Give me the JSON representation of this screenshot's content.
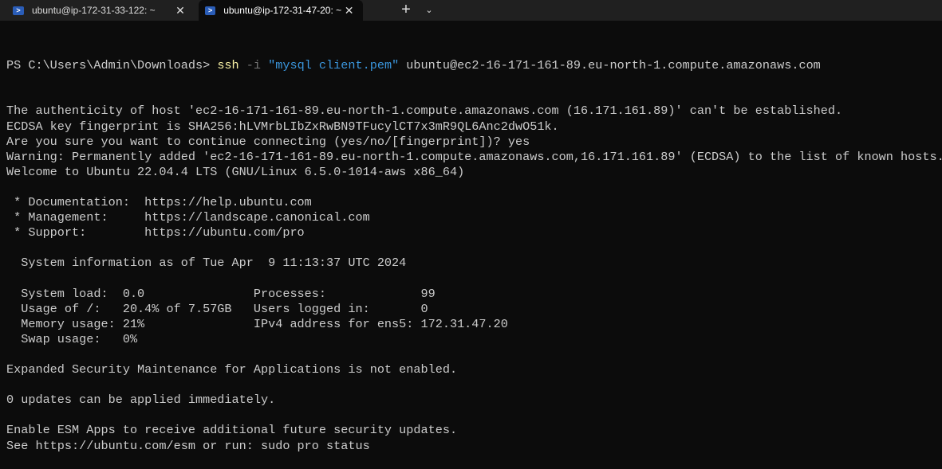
{
  "tabs": [
    {
      "title": "ubuntu@ip-172-31-33-122: ~",
      "icon": "powershell-icon",
      "active": false
    },
    {
      "title": "ubuntu@ip-172-31-47-20: ~",
      "icon": "powershell-icon",
      "active": true
    }
  ],
  "new_tab_label": "+",
  "dropdown_label": "⌄",
  "prompt": {
    "ps": "PS C:\\Users\\Admin\\Downloads> ",
    "cmd": "ssh",
    "flag": " -i ",
    "arg": "\"mysql client.pem\"",
    "rest": " ubuntu@ec2-16-171-161-89.eu-north-1.compute.amazonaws.com"
  },
  "lines": [
    "The authenticity of host 'ec2-16-171-161-89.eu-north-1.compute.amazonaws.com (16.171.161.89)' can't be established.",
    "ECDSA key fingerprint is SHA256:hLVMrbLIbZxRwBN9TFucylCT7x3mR9QL6Anc2dwO51k.",
    "Are you sure you want to continue connecting (yes/no/[fingerprint])? yes",
    "Warning: Permanently added 'ec2-16-171-161-89.eu-north-1.compute.amazonaws.com,16.171.161.89' (ECDSA) to the list of known hosts.",
    "Welcome to Ubuntu 22.04.4 LTS (GNU/Linux 6.5.0-1014-aws x86_64)",
    "",
    " * Documentation:  https://help.ubuntu.com",
    " * Management:     https://landscape.canonical.com",
    " * Support:        https://ubuntu.com/pro",
    "",
    "  System information as of Tue Apr  9 11:13:37 UTC 2024",
    "",
    "  System load:  0.0               Processes:             99",
    "  Usage of /:   20.4% of 7.57GB   Users logged in:       0",
    "  Memory usage: 21%               IPv4 address for ens5: 172.31.47.20",
    "  Swap usage:   0%",
    "",
    "Expanded Security Maintenance for Applications is not enabled.",
    "",
    "0 updates can be applied immediately.",
    "",
    "Enable ESM Apps to receive additional future security updates.",
    "See https://ubuntu.com/esm or run: sudo pro status"
  ]
}
